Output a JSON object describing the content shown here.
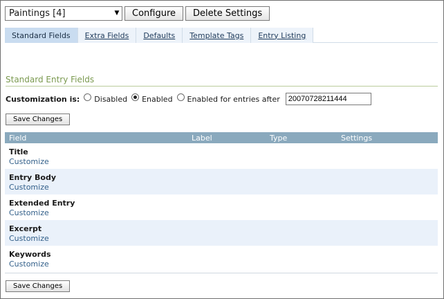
{
  "topbar": {
    "selected_blog": "Paintings [4]",
    "configure_label": "Configure",
    "delete_label": "Delete Settings"
  },
  "tabs": [
    {
      "label": "Standard Fields",
      "active": true
    },
    {
      "label": "Extra Fields",
      "active": false
    },
    {
      "label": "Defaults",
      "active": false
    },
    {
      "label": "Template Tags",
      "active": false
    },
    {
      "label": "Entry Listing",
      "active": false
    }
  ],
  "section": {
    "title": "Standard Entry Fields"
  },
  "customization": {
    "label": "Customization is:",
    "options": [
      {
        "label": "Disabled",
        "selected": false
      },
      {
        "label": "Enabled",
        "selected": true
      },
      {
        "label": "Enabled for entries after",
        "selected": false
      }
    ],
    "after_value": "20070728211444"
  },
  "buttons": {
    "save_label": "Save Changes"
  },
  "table": {
    "headers": [
      "Field",
      "Label",
      "Type",
      "Settings"
    ],
    "rows": [
      {
        "field": "Title",
        "action": "Customize"
      },
      {
        "field": "Entry Body",
        "action": "Customize"
      },
      {
        "field": "Extended Entry",
        "action": "Customize"
      },
      {
        "field": "Excerpt",
        "action": "Customize"
      },
      {
        "field": "Keywords",
        "action": "Customize"
      }
    ]
  }
}
